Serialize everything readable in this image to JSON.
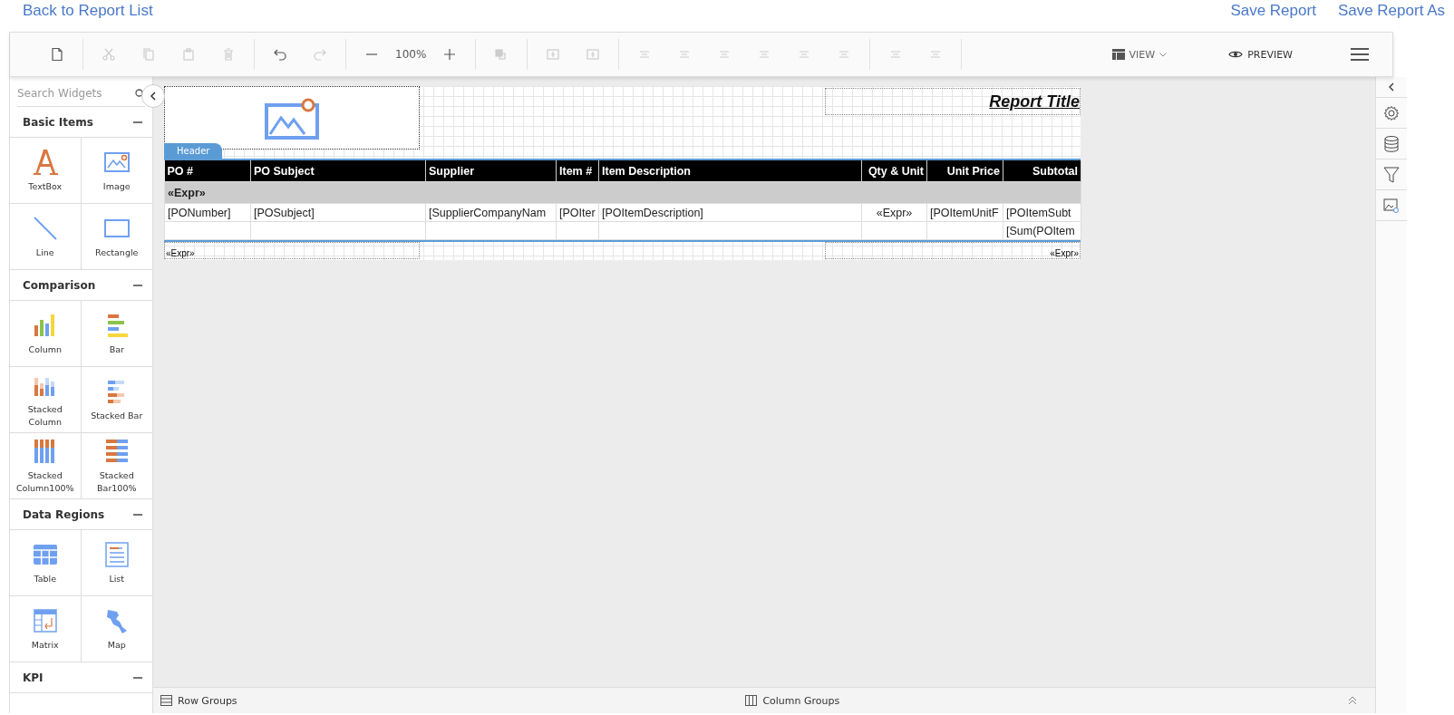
{
  "top_links": {
    "back": "Back to Report List",
    "actions": [
      "Save Report",
      "Save Report As"
    ]
  },
  "toolbar": {
    "groups": [
      [
        {
          "kind": "new",
          "disabled": false
        }
      ],
      [
        {
          "kind": "cut",
          "disabled": true
        },
        {
          "kind": "copy",
          "disabled": true
        },
        {
          "kind": "paste",
          "disabled": true
        },
        {
          "kind": "delete",
          "disabled": true
        }
      ],
      [
        {
          "kind": "undo",
          "disabled": false
        },
        {
          "kind": "redo",
          "disabled": true
        }
      ],
      [
        {
          "kind": "zoom-out",
          "disabled": false
        },
        {
          "kind": "zoom-value",
          "text": "100%",
          "disabled": false
        },
        {
          "kind": "zoom-in",
          "disabled": false
        }
      ],
      [
        {
          "kind": "fill",
          "disabled": true
        }
      ],
      [
        {
          "kind": "bring-front",
          "disabled": true
        },
        {
          "kind": "send-back",
          "disabled": true
        }
      ],
      [
        {
          "kind": "align-left",
          "disabled": true
        },
        {
          "kind": "align-center",
          "disabled": true
        },
        {
          "kind": "align-right",
          "disabled": true
        },
        {
          "kind": "align-top",
          "disabled": true
        },
        {
          "kind": "align-middle",
          "disabled": true
        },
        {
          "kind": "align-bottom",
          "disabled": true
        }
      ],
      [
        {
          "kind": "space-horizontal",
          "disabled": true
        },
        {
          "kind": "space-vertical",
          "disabled": true
        }
      ]
    ],
    "view": "VIEW",
    "preview": "PREVIEW"
  },
  "sidebar": {
    "search": {
      "placeholder": "Search Widgets"
    },
    "sections": [
      {
        "title": "Basic Items",
        "expanded": true,
        "items": [
          {
            "label": "TextBox",
            "kind": "textbox"
          },
          {
            "label": "Image",
            "kind": "image"
          },
          {
            "label": "Line",
            "kind": "line"
          },
          {
            "label": "Rectangle",
            "kind": "rectangle"
          }
        ]
      },
      {
        "title": "Comparison",
        "expanded": true,
        "items": [
          {
            "label": "Column",
            "kind": "column"
          },
          {
            "label": "Bar",
            "kind": "bar"
          },
          {
            "label": "Stacked Column",
            "kind": "stacked-column"
          },
          {
            "label": "Stacked Bar",
            "kind": "stacked-bar"
          },
          {
            "label": "Stacked Column100%",
            "kind": "stacked-column100"
          },
          {
            "label": "Stacked Bar100%",
            "kind": "stacked-bar100"
          }
        ]
      },
      {
        "title": "Data Regions",
        "expanded": true,
        "items": [
          {
            "label": "Table",
            "kind": "table"
          },
          {
            "label": "List",
            "kind": "list"
          },
          {
            "label": "Matrix",
            "kind": "matrix"
          },
          {
            "label": "Map",
            "kind": "map"
          }
        ]
      },
      {
        "title": "KPI",
        "expanded": true
      }
    ]
  },
  "report": {
    "header_tab": "Header",
    "title": "Report Title",
    "table": {
      "columns": [
        "PO #",
        "PO Subject",
        "Supplier",
        "Item #",
        "Item Description",
        "Qty & Unit",
        "Unit Price",
        "Subtotal"
      ],
      "group_row": "«Expr»",
      "detail_row": [
        "[PONumber]",
        "[POSubject]",
        "[SupplierCompanyNam",
        "[POIter",
        "[POItemDescription]",
        "«Expr»",
        "[POItemUnitF",
        "[POItemSubt"
      ],
      "total_row": {
        "subtotal": "[Sum(POItem"
      }
    },
    "footer_left": "«Expr»",
    "footer_right": "«Expr»"
  },
  "bottom_bar": {
    "row_groups": "Row Groups",
    "column_groups": "Column Groups"
  }
}
